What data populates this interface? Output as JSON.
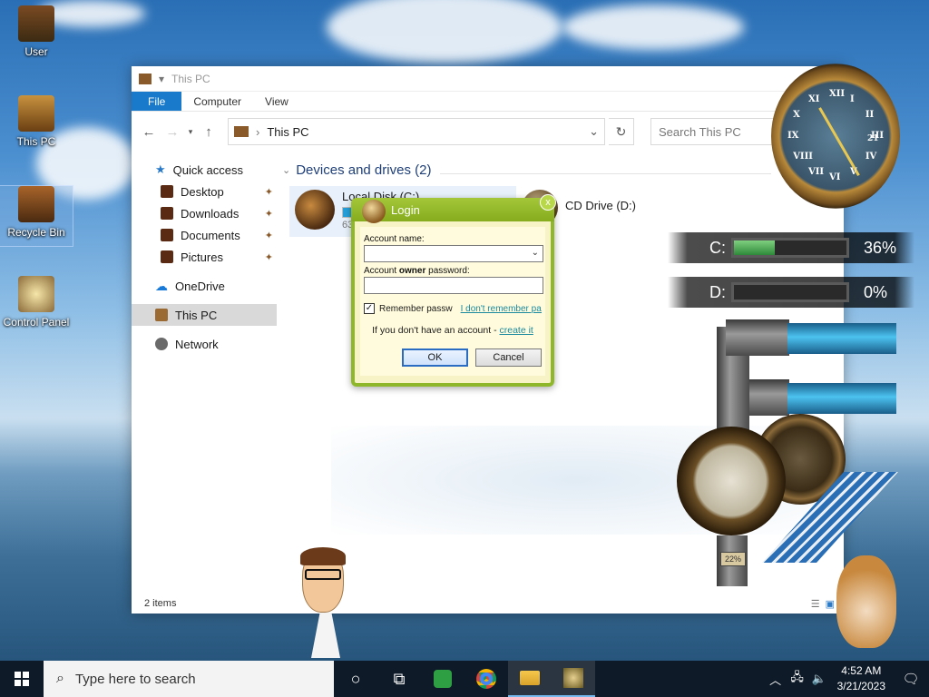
{
  "desktop": {
    "icons": [
      {
        "label": "User"
      },
      {
        "label": "This PC"
      },
      {
        "label": "Recycle Bin"
      },
      {
        "label": "Control Panel"
      }
    ]
  },
  "explorer": {
    "title": "This PC",
    "ribbon_tabs": [
      "File",
      "Computer",
      "View"
    ],
    "address": "This PC",
    "search_placeholder": "Search This PC",
    "nav": {
      "quick_access": "Quick access",
      "desktop": "Desktop",
      "downloads": "Downloads",
      "documents": "Documents",
      "pictures": "Pictures",
      "onedrive": "OneDrive",
      "this_pc": "This PC",
      "network": "Network"
    },
    "group_header": "Devices and drives (2)",
    "drives": [
      {
        "name": "Local Disk (C:)",
        "usage_fraction": 0.36,
        "sub": "63"
      },
      {
        "name": "CD Drive (D:)"
      }
    ],
    "status": "2 items"
  },
  "login": {
    "title": "Login",
    "close_glyph": "x",
    "account_name_label": "Account name:",
    "password_label_pre": "Account ",
    "password_label_bold": "owner",
    "password_label_post": " password:",
    "remember_label": "Remember passw",
    "forgot_link": "I don't remember pas",
    "no_account_text": "If you don't have an account - ",
    "create_link": "create it",
    "ok_label": "OK",
    "cancel_label": "Cancel"
  },
  "widgets": {
    "clock": {
      "numerals": [
        "XII",
        "I",
        "II",
        "III",
        "IV",
        "V",
        "VI",
        "VII",
        "VIII",
        "IX",
        "X",
        "XI"
      ],
      "date": "21"
    },
    "gauges": [
      {
        "label": "C:",
        "percent_text": "36%",
        "fraction": 0.36
      },
      {
        "label": "D:",
        "percent_text": "0%",
        "fraction": 0
      }
    ],
    "pipe_gauge_text": "22%"
  },
  "taskbar": {
    "search_placeholder": "Type here to search",
    "time": "4:52 AM",
    "date": "3/21/2023"
  },
  "colors": {
    "accent": "#1979ca",
    "login_border": "#8fb72a",
    "taskbar": "#0e1a28"
  }
}
